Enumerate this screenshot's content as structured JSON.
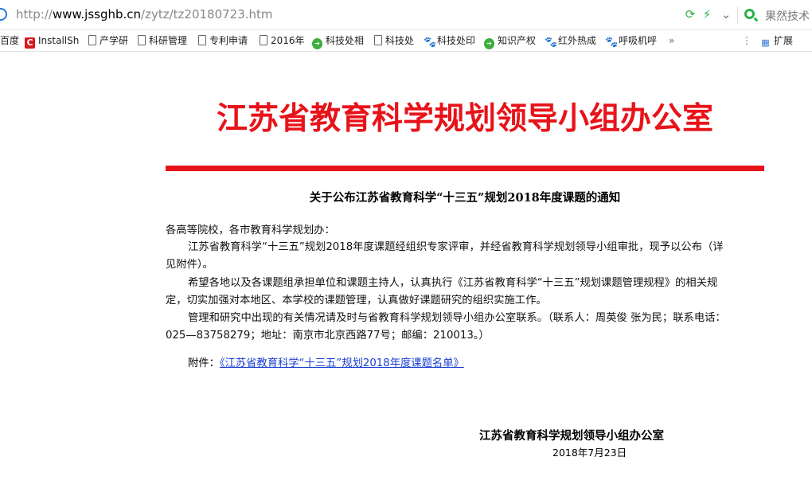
{
  "browser": {
    "url_prefix": "http://",
    "url_host": "www.jssghb.cn",
    "url_path": "/zytz/tz20180723.htm",
    "search_placeholder": "果然技术",
    "bookmarks": [
      {
        "label": "百度",
        "icon": "partial-icon"
      },
      {
        "label": "InstallSh",
        "icon": "installshield-icon"
      },
      {
        "label": "产学研",
        "icon": "page-icon"
      },
      {
        "label": "科研管理",
        "icon": "page-icon"
      },
      {
        "label": "专利申请",
        "icon": "page-icon"
      },
      {
        "label": "2016年",
        "icon": "page-icon"
      },
      {
        "label": "科技处相",
        "icon": "green-circle-icon"
      },
      {
        "label": "科技处",
        "icon": "page-icon"
      },
      {
        "label": "科技处印",
        "icon": "paw-icon"
      },
      {
        "label": "知识产权",
        "icon": "green-circle-icon"
      },
      {
        "label": "红外热成",
        "icon": "paw-icon"
      },
      {
        "label": "呼吸机呼",
        "icon": "paw-icon"
      }
    ],
    "overflow_label": "»",
    "extensions_label": "扩展"
  },
  "page": {
    "title": "江苏省教育科学规划领导小组办公室",
    "notice_title": "关于公布江苏省教育科学“十三五”规划2018年度课题的通知",
    "salutation": "各高等院校，各市教育科学规划办：",
    "para1_line1": "江苏省教育科学“十三五”规划2018年度课题经组织专家评审，并经省教育科学规划领导小组审批，现予以公布（详",
    "para1_line2": "见附件）。",
    "para2_line1": "希望各地以及各课题组承担单位和课题主持人，认真执行《江苏省教育科学“十三五”规划课题管理规程》的相关规",
    "para2_line2": "定，切实加强对本地区、本学校的课题管理，认真做好课题研究的组织实施工作。",
    "para3_line1": "管理和研究中出现的有关情况请及时与省教育科学规划领导小组办公室联系。（联系人：周英俊 张为民；联系电话：",
    "para3_line2": "025—83758279；地址：南京市北京西路77号；邮编：210013。）",
    "attachment_label": "附件：",
    "attachment_link": "《江苏省教育科学“十三五”规划2018年度课题名单》",
    "sign_office": "江苏省教育科学规划领导小组办公室",
    "sign_date": "2018年7月23日"
  },
  "colors": {
    "title_red": "#e8131a",
    "link_blue": "#1a3fd0"
  }
}
